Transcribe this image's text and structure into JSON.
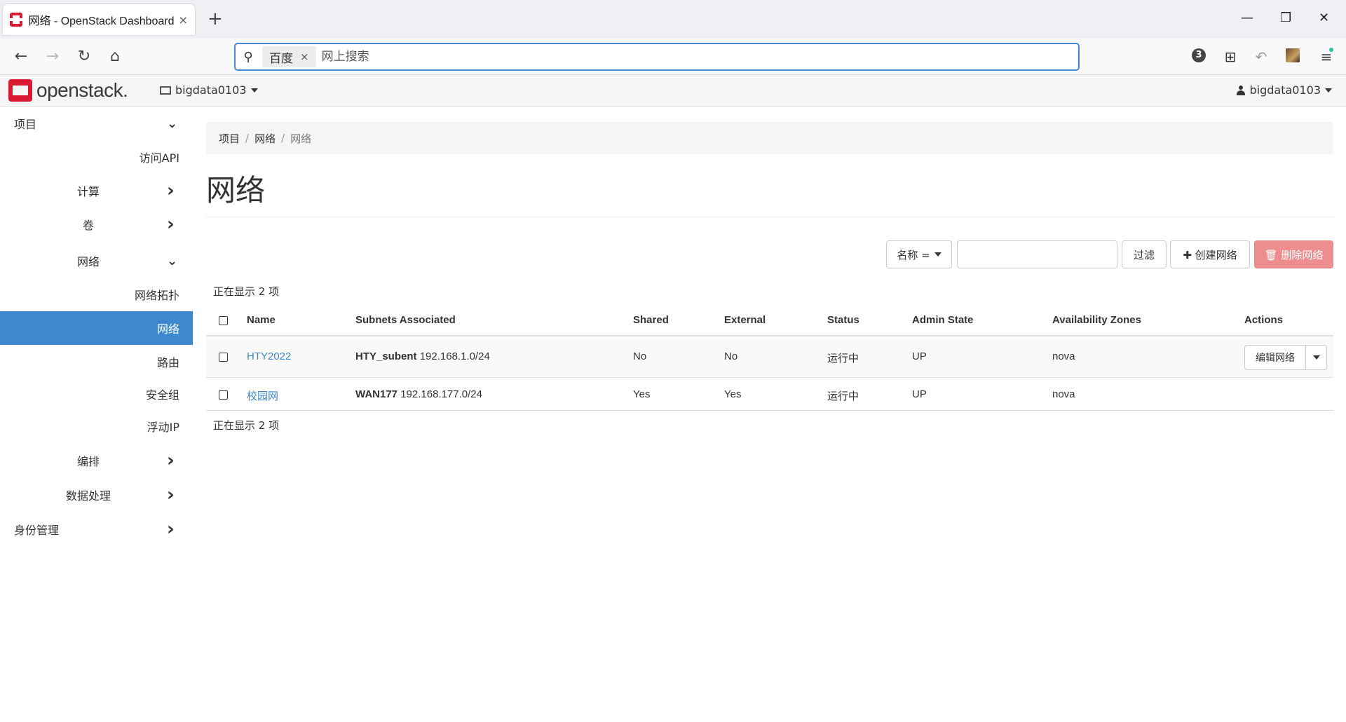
{
  "browser": {
    "tab_title": "网络 - OpenStack Dashboard",
    "tab_close": "×",
    "new_tab": "+",
    "search_engine": "百度",
    "search_engine_close": "×",
    "search_placeholder": "网上搜索",
    "extension_badge": "3"
  },
  "header": {
    "logo_text": "openstack.",
    "project": "bigdata0103",
    "user": "bigdata0103"
  },
  "sidebar": {
    "items": [
      {
        "label": "项目",
        "chevron": "⌄"
      },
      {
        "label": "访问API"
      },
      {
        "label": "计算",
        "chevron": "›"
      },
      {
        "label": "卷",
        "chevron": "›"
      },
      {
        "label": "网络",
        "chevron": "⌄"
      },
      {
        "label": "网络拓扑"
      },
      {
        "label": "网络"
      },
      {
        "label": "路由"
      },
      {
        "label": "安全组"
      },
      {
        "label": "浮动IP"
      },
      {
        "label": "编排",
        "chevron": "›"
      },
      {
        "label": "数据处理",
        "chevron": "›"
      },
      {
        "label": "身份管理",
        "chevron": "›"
      }
    ]
  },
  "breadcrumb": {
    "items": [
      "项目",
      "网络",
      "网络"
    ],
    "sep": "/"
  },
  "page": {
    "title": "网络",
    "filter_select": "名称 =",
    "filter_button": "过滤",
    "create_button": "✚ 创建网络",
    "delete_button": "🗑 删除网络",
    "count_text": "正在显示 2 项"
  },
  "table": {
    "headers": [
      "Name",
      "Subnets Associated",
      "Shared",
      "External",
      "Status",
      "Admin State",
      "Availability Zones",
      "Actions"
    ],
    "rows": [
      {
        "name": "HTY2022",
        "subnet_name": "HTY_subent",
        "subnet_cidr": "192.168.1.0/24",
        "shared": "No",
        "external": "No",
        "status": "运行中",
        "admin_state": "UP",
        "az": "nova",
        "action": "编辑网络"
      },
      {
        "name": "校园网",
        "subnet_name": "WAN177",
        "subnet_cidr": "192.168.177.0/24",
        "shared": "Yes",
        "external": "Yes",
        "status": "运行中",
        "admin_state": "UP",
        "az": "nova",
        "action": ""
      }
    ]
  },
  "colors": {
    "accent": "#3d88cf",
    "brand": "#da1a32",
    "danger": "#ee8d8d"
  }
}
